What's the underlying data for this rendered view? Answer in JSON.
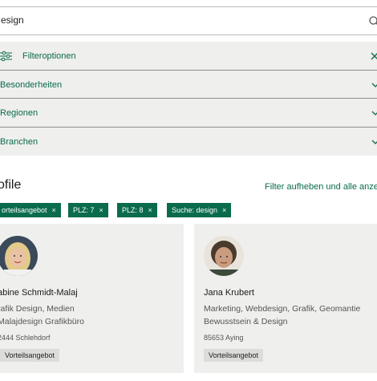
{
  "search": {
    "value": "esign"
  },
  "filters": {
    "options_label": "Filteroptionen",
    "rows": [
      {
        "label": "Besonderheiten"
      },
      {
        "label": "Regionen"
      },
      {
        "label": "Branchen"
      }
    ]
  },
  "profiles": {
    "title": "ofile",
    "clear_link": "Filter aufheben und alle anzeig"
  },
  "active_filters": [
    {
      "label": "orteilsangebot",
      "remove": "×"
    },
    {
      "label": "PLZ: 7",
      "remove": "×"
    },
    {
      "label": "PLZ: 8",
      "remove": "×"
    },
    {
      "label": "Suche: design",
      "remove": "×"
    }
  ],
  "cards": [
    {
      "name": "abine Schmidt-Malaj",
      "tags_line1": "rafik Design, Medien",
      "tags_line2": "Malajdesign Grafikbüro",
      "location": "2444 Schlehdorf",
      "badge": "Vorteilsangebot"
    },
    {
      "name": "Jana Krubert",
      "tags_line1": "Marketing, Webdesign, Grafik, Geomantie",
      "tags_line2": "Bewusstsein & Design",
      "location": "85653 Aying",
      "badge": "Vorteilsangebot"
    }
  ],
  "colors": {
    "accent": "#0a6b4d",
    "panel": "#efefed"
  }
}
